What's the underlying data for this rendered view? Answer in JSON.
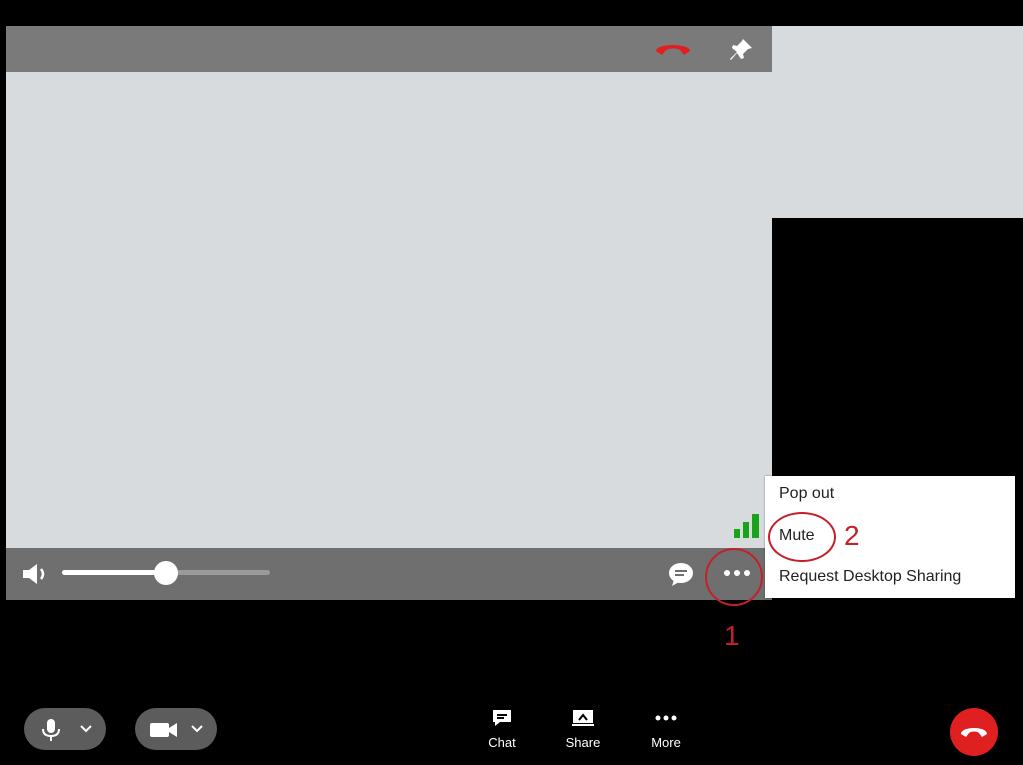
{
  "context_menu": {
    "items": [
      "Pop out",
      "Mute",
      "Request Desktop Sharing"
    ]
  },
  "annotations": {
    "step1": "1",
    "step2": "2"
  },
  "toolbar": {
    "chat_label": "Chat",
    "share_label": "Share",
    "more_label": "More"
  },
  "volume": {
    "level": 0.5
  },
  "colors": {
    "accent_red": "#e02020",
    "annotation_red": "#c4202a",
    "signal_green": "#1aa31a"
  },
  "icons": [
    "hangup-icon",
    "pin-icon",
    "speaker-icon",
    "chat-bubble-icon",
    "more-dots-icon",
    "signal-icon",
    "microphone-icon",
    "chevron-down-icon",
    "camera-icon",
    "chat-icon",
    "share-icon",
    "more-icon",
    "end-call-icon"
  ]
}
